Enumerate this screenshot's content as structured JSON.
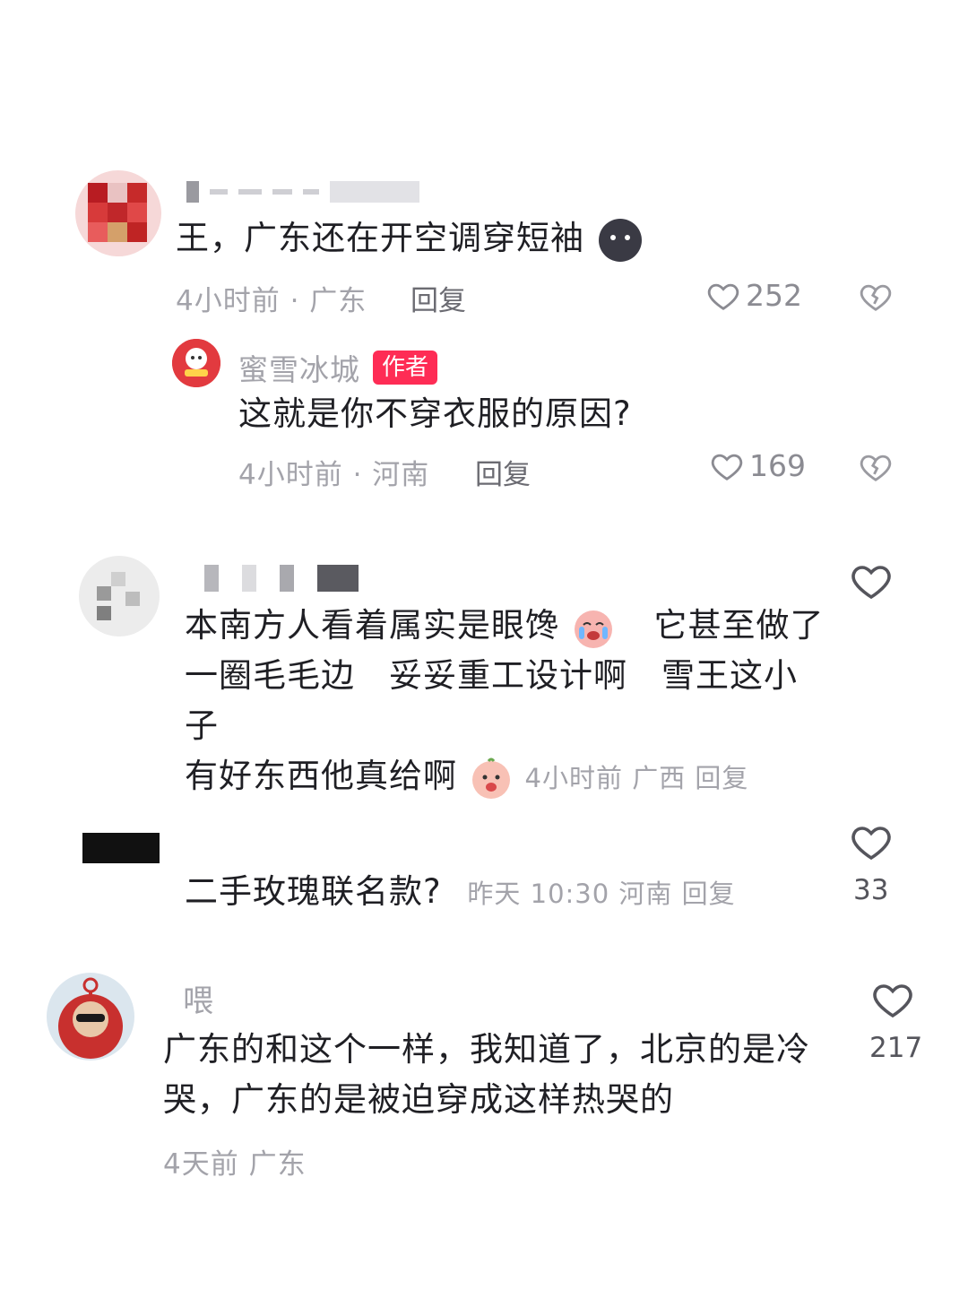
{
  "comments": [
    {
      "text": "王，广东还在开空调穿短袖",
      "time_loc": "4小时前 · 广东",
      "reply": "回复",
      "likes": "252",
      "sub_reply": {
        "username": "蜜雪冰城",
        "badge": "作者",
        "text": "这就是你不穿衣服的原因?",
        "time_loc": "4小时前 · 河南",
        "reply": "回复",
        "likes": "169"
      }
    },
    {
      "text_line1": "本南方人看着属实是眼馋",
      "text_line1b": "它甚至做了",
      "text_line2": "一圈毛毛边　妥妥重工设计啊　雪王这小子",
      "text_line3": "有好东西他真给啊",
      "meta_inline": "4小时前 广西 回复"
    },
    {
      "text": "二手玫瑰联名款?",
      "meta_inline": "昨天 10:30 河南 回复",
      "likes": "33"
    },
    {
      "username": "喂",
      "text_line1": "广东的和这个一样，我知道了，北京的是冷",
      "text_line2": "哭，广东的是被迫穿成这样热哭的",
      "time_loc": "4天前 广东",
      "likes": "217"
    }
  ],
  "colors": {
    "accent_badge": "#fe2c55",
    "meta": "#a3a3aa",
    "text": "#1f1f24"
  },
  "icons": [
    "heart-icon",
    "broken-heart-icon",
    "avatar-icon"
  ]
}
